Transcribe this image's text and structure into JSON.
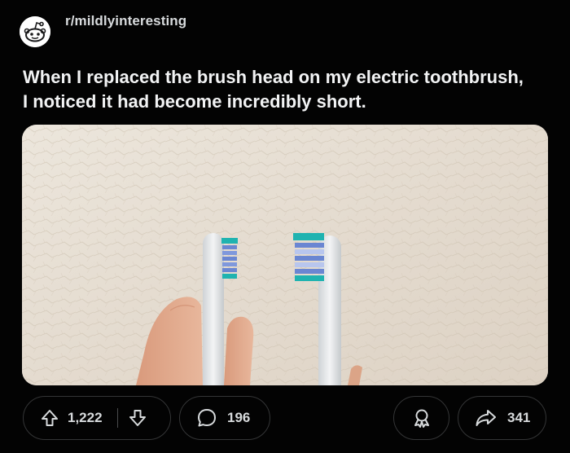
{
  "post": {
    "subreddit": "r/mildlyinteresting",
    "title_line1": "When I replaced the brush head on my electric toothbrush,",
    "title_line2": "I noticed it had become incredibly short."
  },
  "actions": {
    "upvotes": "1,222",
    "comments": "196",
    "shares": "341"
  },
  "icons": {
    "avatar": "reddit-snoo-icon",
    "upvote": "arrow-up-icon",
    "downvote": "arrow-down-icon",
    "comment": "speech-bubble-icon",
    "award": "award-ribbon-icon",
    "share": "share-arrow-icon"
  },
  "colors": {
    "background": "#030303",
    "text": "#d7dadc",
    "pill_border": "#343536",
    "bristle_teal": "#1fb3b0",
    "bristle_blue": "#5b7fd6"
  }
}
